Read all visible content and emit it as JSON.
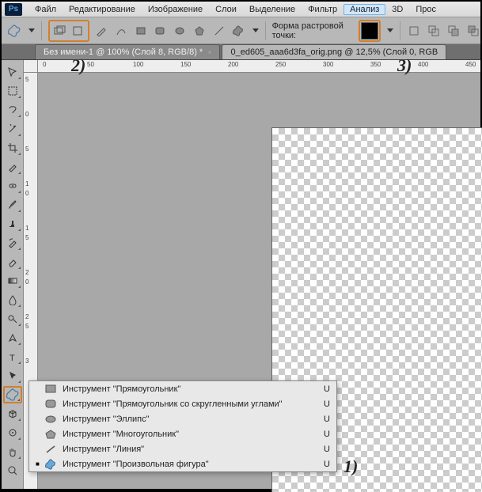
{
  "app": {
    "logo": "Ps"
  },
  "menu": {
    "items": [
      "Файл",
      "Редактирование",
      "Изображение",
      "Слои",
      "Выделение",
      "Фильтр",
      "Анализ",
      "3D",
      "Прос"
    ]
  },
  "options": {
    "label": "Форма растровой точки:",
    "color": "#000000"
  },
  "tabs": [
    {
      "title": "Без имени-1 @ 100% (Слой 8, RGB/8) *",
      "active": false
    },
    {
      "title": "0_ed605_aaa6d3fa_orig.png @ 12,5% (Слой 0, RGB",
      "active": true
    }
  ],
  "ruler": {
    "h": [
      "0",
      "50",
      "100",
      "150",
      "200",
      "250",
      "300",
      "350",
      "400",
      "450"
    ],
    "v": [
      "5",
      "0",
      "5",
      "1",
      "0",
      "1",
      "5",
      "2",
      "0",
      "2",
      "5",
      "3"
    ]
  },
  "flyout": {
    "items": [
      {
        "label": "Инструмент \"Прямоугольник\"",
        "key": "U",
        "icon": "rect"
      },
      {
        "label": "Инструмент \"Прямоугольник со скругленными углами\"",
        "key": "U",
        "icon": "roundrect"
      },
      {
        "label": "Инструмент \"Эллипс\"",
        "key": "U",
        "icon": "ellipse"
      },
      {
        "label": "Инструмент \"Многоугольник\"",
        "key": "U",
        "icon": "polygon"
      },
      {
        "label": "Инструмент \"Линия\"",
        "key": "U",
        "icon": "line"
      },
      {
        "label": "Инструмент \"Произвольная фигура\"",
        "key": "U",
        "icon": "blob",
        "selected": true
      }
    ]
  },
  "annotations": {
    "a1": "1)",
    "a2": "2)",
    "a3": "3)"
  }
}
